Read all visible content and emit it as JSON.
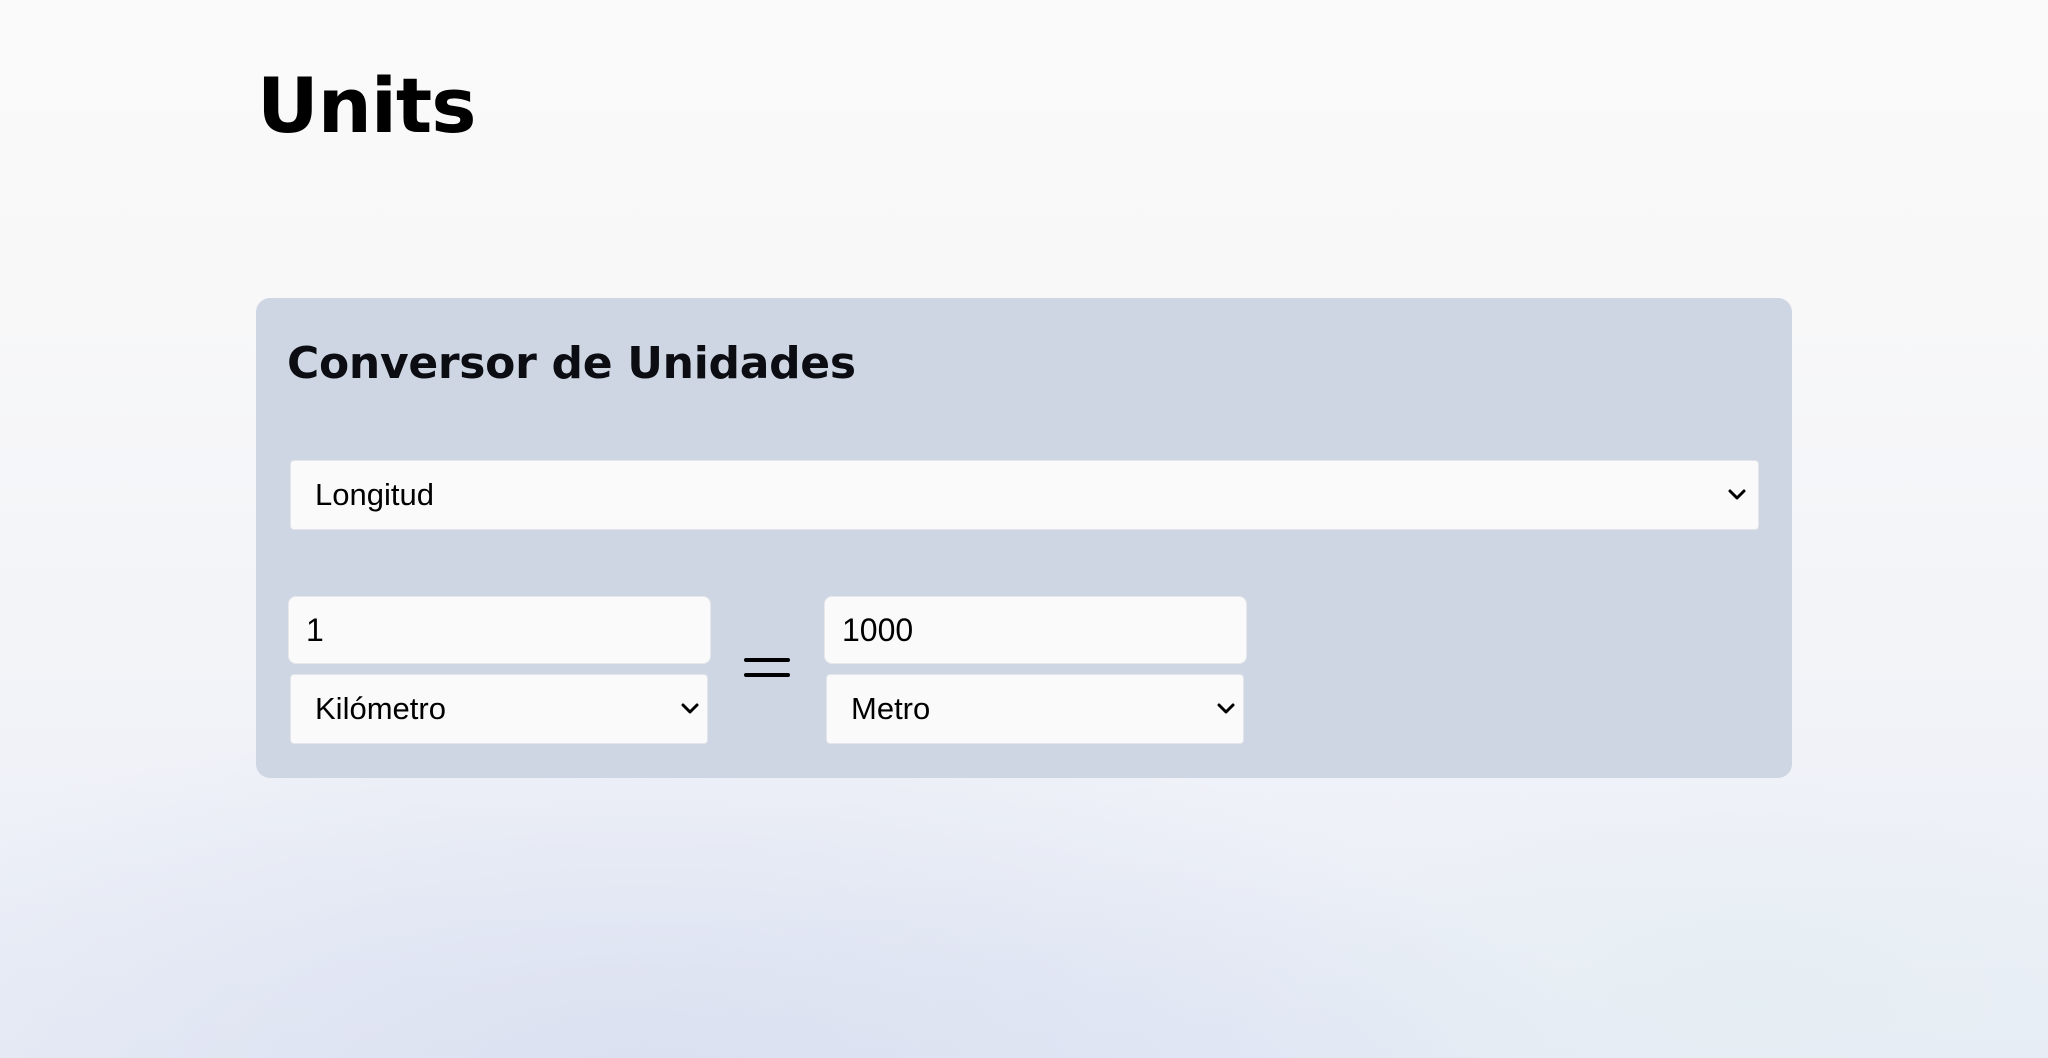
{
  "page": {
    "title": "Units"
  },
  "converter": {
    "title": "Conversor de Unidades",
    "category": {
      "selected": "Longitud",
      "icon": "chevron-down-icon"
    },
    "from": {
      "value": "1",
      "unit": "Kilómetro",
      "icon": "chevron-down-icon"
    },
    "equals_icon": "equals-icon",
    "to": {
      "value": "1000",
      "unit": "Metro",
      "icon": "chevron-down-icon"
    }
  },
  "colors": {
    "card_background": "#cfd6e3",
    "field_background": "#fafafa",
    "text": "#000000"
  }
}
